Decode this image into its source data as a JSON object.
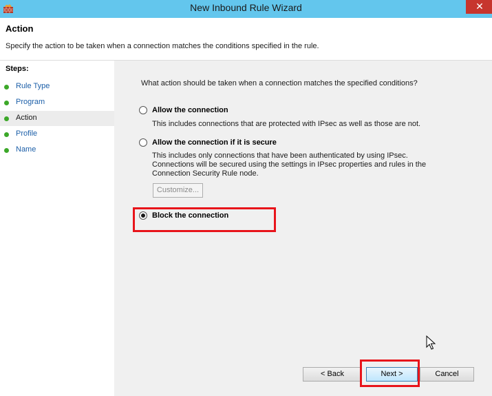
{
  "window": {
    "title": "New Inbound Rule Wizard",
    "close_glyph": "✕",
    "app_icon": "firewall-icon"
  },
  "header": {
    "title": "Action",
    "description": "Specify the action to be taken when a connection matches the conditions specified in the rule."
  },
  "steps": {
    "label": "Steps:",
    "items": [
      {
        "label": "Rule Type",
        "current": false
      },
      {
        "label": "Program",
        "current": false
      },
      {
        "label": "Action",
        "current": true
      },
      {
        "label": "Profile",
        "current": false
      },
      {
        "label": "Name",
        "current": false
      }
    ]
  },
  "content": {
    "question": "What action should be taken when a connection matches the specified conditions?",
    "options": [
      {
        "title": "Allow the connection",
        "description": "This includes connections that are protected with IPsec as well as those are not.",
        "selected": false
      },
      {
        "title": "Allow the connection if it is secure",
        "description": "This includes only connections that have been authenticated by using IPsec.  Connections will be secured using the settings in IPsec properties and rules in the Connection Security Rule node.",
        "selected": false
      },
      {
        "title": "Block the connection",
        "description": "",
        "selected": true
      }
    ],
    "customize_label": "Customize..."
  },
  "buttons": {
    "back_label": "< Back",
    "next_label": "Next >",
    "cancel_label": "Cancel"
  },
  "colors": {
    "titlebar": "#63c6ed",
    "close": "#c7352d",
    "highlight": "#e8141a",
    "step_dot": "#3ca829",
    "step_link": "#1c5fa8"
  }
}
